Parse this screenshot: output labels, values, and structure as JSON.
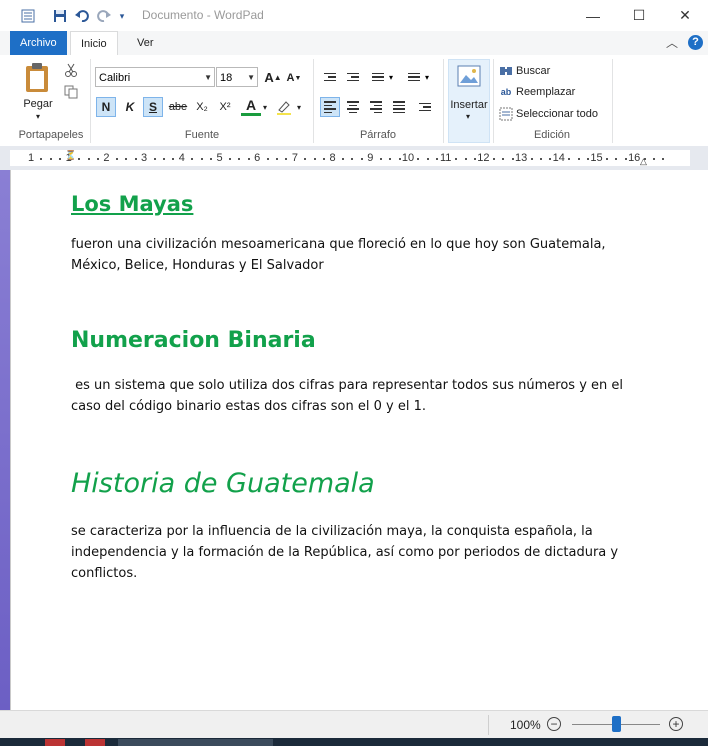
{
  "window": {
    "title": "Documento - WordPad",
    "minimize_glyph": "—",
    "maximize_glyph": "☐",
    "close_glyph": "✕"
  },
  "tabs": {
    "file": "Archivo",
    "home": "Inicio",
    "view": "Ver",
    "help": "?"
  },
  "ribbon": {
    "clipboard": {
      "label": "Portapapeles",
      "paste": "Pegar"
    },
    "font": {
      "label": "Fuente",
      "family": "Calibri",
      "size": "18",
      "bold": "N",
      "italic": "K",
      "underline": "S",
      "strikethrough": "abe",
      "subscript": "X₂",
      "superscript": "X²",
      "font_color": "A"
    },
    "paragraph": {
      "label": "Párrafo"
    },
    "insert": {
      "label": "Insertar"
    },
    "editing": {
      "label": "Edición",
      "find": "Buscar",
      "replace": "Reemplazar",
      "select_all": "Seleccionar todo"
    }
  },
  "ruler": {
    "numbers": [
      "1",
      "1",
      "2",
      "3",
      "4",
      "5",
      "6",
      "7",
      "8",
      "9",
      "10",
      "11",
      "12",
      "13",
      "14",
      "15",
      "16"
    ]
  },
  "document": {
    "heading1": "Los Mayas",
    "para1": "fueron una civilización mesoamericana que floreció en lo que hoy son Guatemala, México, Belice, Honduras y El Salvador",
    "heading2": "Numeracion Binaria",
    "para2": " es un sistema que solo utiliza dos cifras para representar todos sus números y en el caso del código binario estas dos cifras son el 0 y el 1.",
    "heading3": "Historia de Guatemala",
    "para3": "se caracteriza por la influencia de la civilización maya, la conquista española, la independencia y la formación de la República, así como por periodos de dictadura y conflictos.",
    "heading_color": "#12a14b"
  },
  "status": {
    "zoom": "100%",
    "zoom_fraction": 0.5
  }
}
